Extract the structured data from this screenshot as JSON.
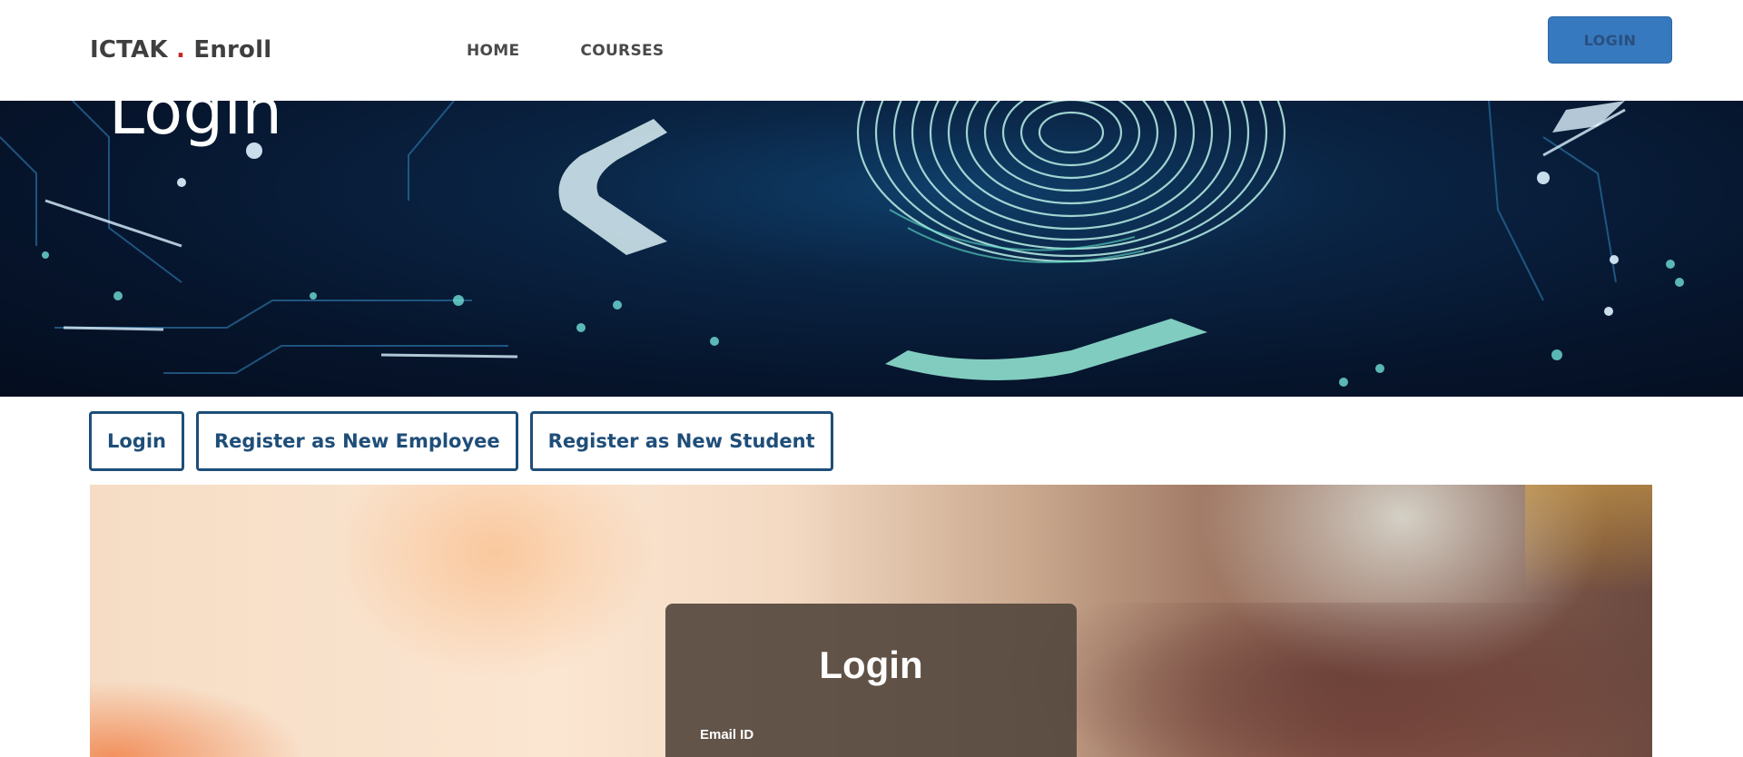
{
  "header": {
    "brand_name": "ICTAK",
    "brand_dot": ".",
    "brand_suffix": "Enroll",
    "nav": [
      {
        "label": "HOME"
      },
      {
        "label": "COURSES"
      }
    ],
    "login_button": "LOGIN"
  },
  "hero": {
    "title": "Login"
  },
  "tabs": [
    {
      "label": "Login"
    },
    {
      "label": "Register as New Employee"
    },
    {
      "label": "Register as New Student"
    }
  ],
  "login_form": {
    "title": "Login",
    "email_label": "Email ID",
    "email_value": "",
    "email_placeholder": ""
  },
  "colors": {
    "accent": "#3679bf",
    "tab_border": "#1f4e79",
    "brand_dot": "#c62828"
  }
}
